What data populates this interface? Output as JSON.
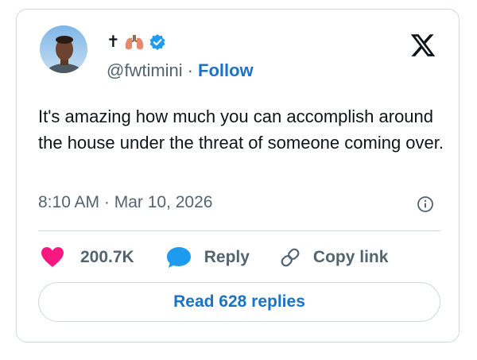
{
  "author": {
    "display_name_text": "✝",
    "display_name_icons": [
      "cross-glyph",
      "lungs-emoji",
      "verified-badge-icon"
    ],
    "handle": "@fwtimini",
    "separator": "·",
    "follow_label": "Follow"
  },
  "platform_logo": "x-logo-icon",
  "tweet": {
    "text": "It's amazing how much you can accomplish around the house under the threat of someone coming over.",
    "timestamp": "8:10 AM · Mar 10, 2026"
  },
  "actions": {
    "like_count": "200.7K",
    "reply_label": "Reply",
    "copy_link_label": "Copy link"
  },
  "read_replies_label": "Read 628 replies",
  "colors": {
    "accent": "#1a73c7",
    "like": "#f91880",
    "reply_bubble": "#1d9bf0",
    "verified": "#1d9bf0",
    "muted": "#536471",
    "border": "#cfd9de"
  }
}
